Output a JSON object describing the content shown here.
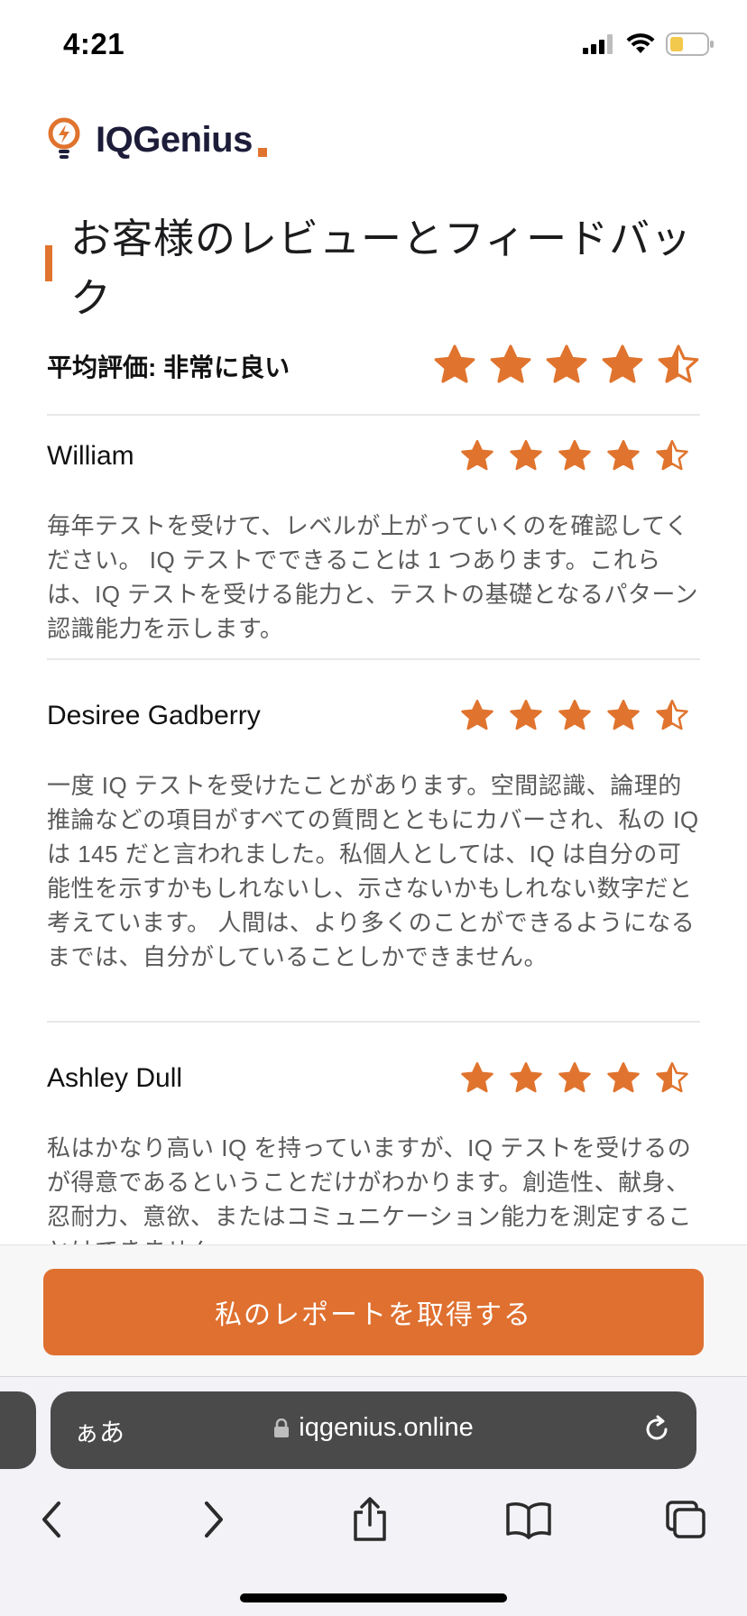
{
  "status": {
    "time": "4:21"
  },
  "brand": {
    "name": "IQGenius",
    "icon": "lightbulb-bolt-icon",
    "accent_color": "#e0742e"
  },
  "heading": "お客様のレビューとフィードバック",
  "average": {
    "label": "平均評価: 非常に良い",
    "rating": 4.5
  },
  "reviews": [
    {
      "name": "William",
      "rating": 4.5,
      "text": "毎年テストを受けて、レベルが上がっていくのを確認してください。 IQ テストでできることは 1 つあります。これらは、IQ テストを受ける能力と、テストの基礎となるパターン認識能力を示します。"
    },
    {
      "name": "Desiree Gadberry",
      "rating": 4.5,
      "text": "一度 IQ テストを受けたことがあります。空間認識、論理的推論などの項目がすべての質問とともにカバーされ、私の IQ は 145 だと言われました。私個人としては、IQ は自分の可能性を示すかもしれないし、示さないかもしれない数字だと考えています。 人間は、より多くのことができるようになるまでは、自分がしていることしかできません。"
    },
    {
      "name": "Ashley Dull",
      "rating": 4.5,
      "text": "私はかなり高い IQ を持っていますが、IQ テストを受けるのが得意であるということだけがわかります。創造性、献身、忍耐力、意欲、またはコミュニケーション能力を測定することはできません。"
    }
  ],
  "cta": {
    "label": "私のレポートを取得する",
    "color": "#df7030"
  },
  "browser": {
    "aa_label": "ぁあ",
    "url": "iqgenius.online"
  }
}
